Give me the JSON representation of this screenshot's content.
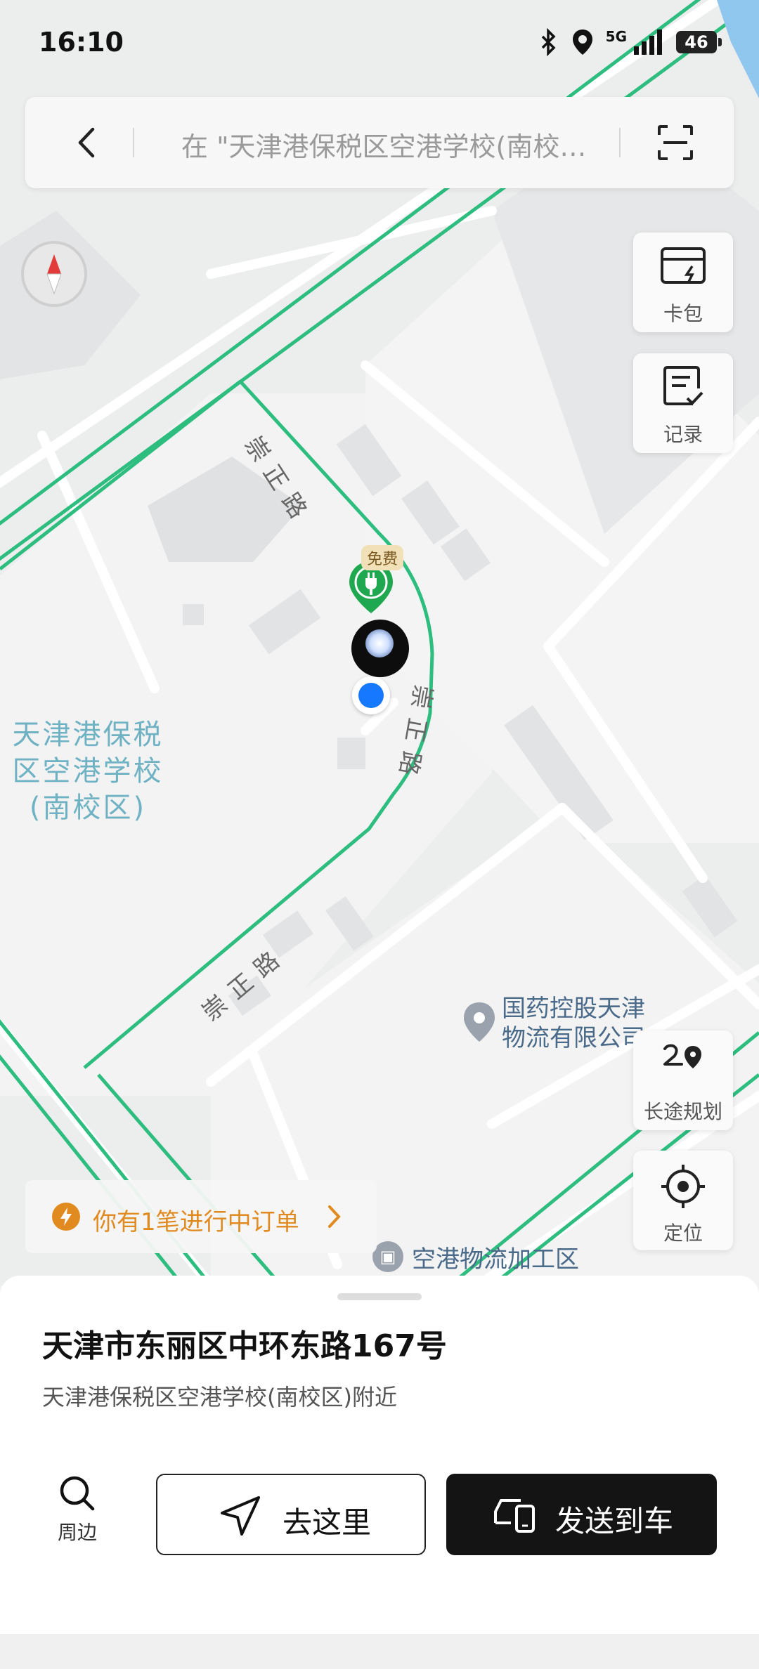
{
  "status_bar": {
    "time": "16:10",
    "battery": "46",
    "network": "5G"
  },
  "search": {
    "placeholder": "在 \"天津港保税区空港学校(南校…"
  },
  "side_buttons": {
    "card_pack": "卡包",
    "records": "记录",
    "long_route": "长途规划",
    "locate": "定位"
  },
  "map": {
    "school_label_lines": [
      "天津港保税",
      "区空港学校",
      "(南校区)"
    ],
    "road_name": "崇正路",
    "poi_sinopharm_lines": [
      "国药控股天津",
      "物流有限公司"
    ],
    "poi_processing_zone": "空港物流加工区",
    "free_badge": "免费"
  },
  "order_banner": {
    "text": "你有1笔进行中订单"
  },
  "sheet": {
    "address": "天津市东丽区中环东路167号",
    "nearby_desc": "天津港保税区空港学校(南校区)附近",
    "nearby_label": "周边",
    "go_here": "去这里",
    "send_to_car": "发送到车"
  },
  "colors": {
    "road_green": "#2dbd7f",
    "location_blue": "#1677ff",
    "order_orange": "#e08a1f"
  }
}
